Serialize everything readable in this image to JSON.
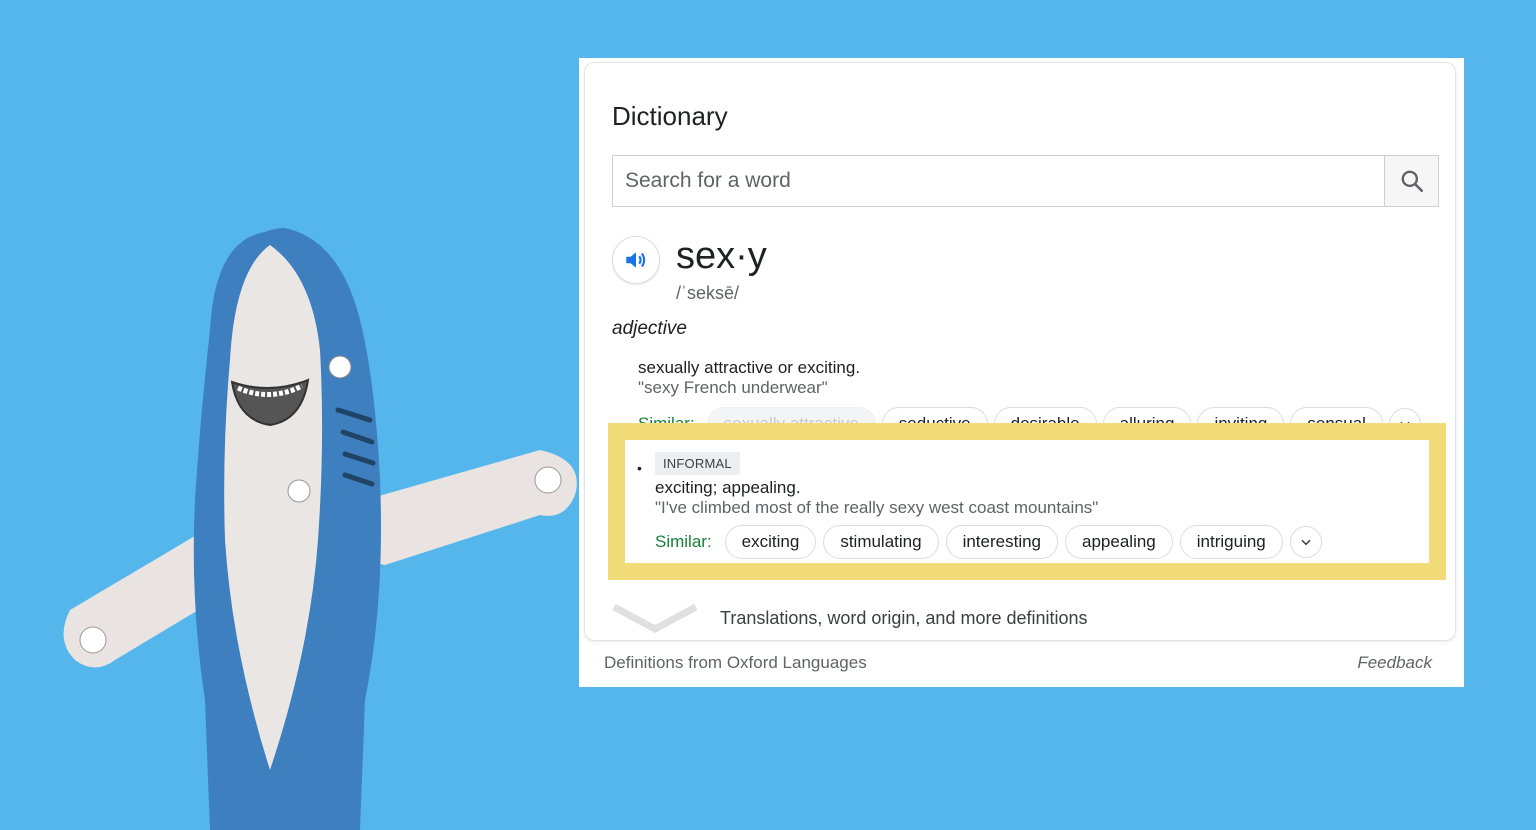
{
  "dictionary": {
    "title": "Dictionary",
    "search_placeholder": "Search for a word",
    "search_icon": "search-icon",
    "speaker_icon": "speaker-icon",
    "word": "sex·y",
    "phonetic": "/ˈseksē/",
    "part_of_speech": "adjective"
  },
  "sense1": {
    "definition": "sexually attractive or exciting.",
    "example": "\"sexy French underwear\"",
    "similar_label": "Similar:",
    "similar": [
      "sexually attractive",
      "seductive",
      "desirable",
      "alluring",
      "inviting",
      "sensual"
    ]
  },
  "sense2": {
    "bullet": "•",
    "tag": "INFORMAL",
    "definition": "exciting; appealing.",
    "example": "\"I've climbed most of the really sexy west coast mountains\"",
    "similar_label": "Similar:",
    "similar": [
      "exciting",
      "stimulating",
      "interesting",
      "appealing",
      "intriguing"
    ]
  },
  "more": {
    "label": "Translations, word origin, and more definitions"
  },
  "footer": {
    "source": "Definitions from Oxford Languages",
    "feedback": "Feedback"
  },
  "colors": {
    "background": "#55b6ec",
    "highlight": "#f2dc79",
    "similar_green": "#188038",
    "speaker_blue": "#1a73e8"
  }
}
